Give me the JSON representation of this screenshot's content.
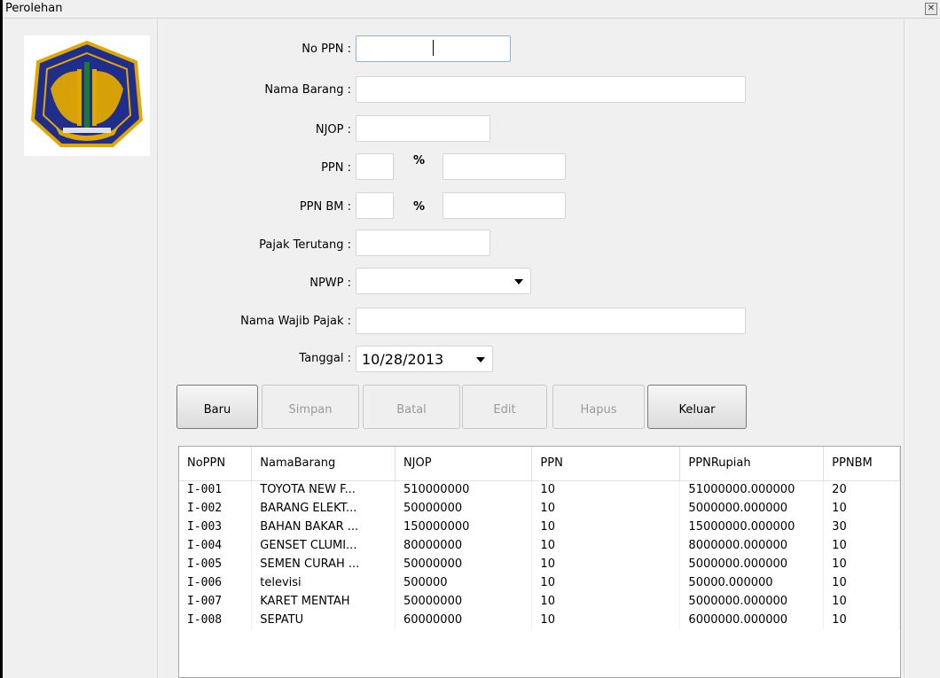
{
  "window": {
    "title": "Perolehan"
  },
  "form": {
    "no_ppn_label": "No PPN :",
    "no_ppn_value": "",
    "nama_barang_label": "Nama Barang :",
    "njop_label": "NJOP :",
    "ppn_label": "PPN :",
    "ppn_bm_label": "PPN BM :",
    "percent": "%",
    "pajak_terutang_label": "Pajak Terutang :",
    "npwp_label": "NPWP :",
    "nama_wajib_pajak_label": "Nama Wajib Pajak :",
    "tanggal_label": "Tanggal :",
    "tanggal_value": "10/28/2013"
  },
  "buttons": {
    "baru": "Baru",
    "simpan": "Simpan",
    "batal": "Batal",
    "edit": "Edit",
    "hapus": "Hapus",
    "keluar": "Keluar"
  },
  "table": {
    "columns": [
      "NoPPN",
      "NamaBarang",
      "NJOP",
      "PPN",
      "PPNRupiah",
      "PPNBM"
    ],
    "rows": [
      [
        "I-001",
        "TOYOTA NEW F...",
        "510000000",
        "10",
        "51000000.000000",
        "20"
      ],
      [
        "I-002",
        "BARANG ELEKT...",
        "50000000",
        "10",
        "5000000.000000",
        "10"
      ],
      [
        "I-003",
        "BAHAN BAKAR ...",
        "150000000",
        "10",
        "15000000.000000",
        "30"
      ],
      [
        "I-004",
        "GENSET CLUMI...",
        "80000000",
        "10",
        "8000000.000000",
        "10"
      ],
      [
        "I-005",
        "SEMEN CURAH ...",
        "50000000",
        "10",
        "5000000.000000",
        "10"
      ],
      [
        "I-006",
        "televisi",
        "500000",
        "10",
        "50000.000000",
        "10"
      ],
      [
        "I-007",
        "KARET MENTAH",
        "50000000",
        "10",
        "5000000.000000",
        "10"
      ],
      [
        "I-008",
        "SEPATU",
        "60000000",
        "10",
        "6000000.000000",
        "10"
      ]
    ]
  },
  "colors": {
    "logo_gold": "#e0a800",
    "logo_blue": "#1f2d8c",
    "logo_green": "#1e7a2e"
  }
}
